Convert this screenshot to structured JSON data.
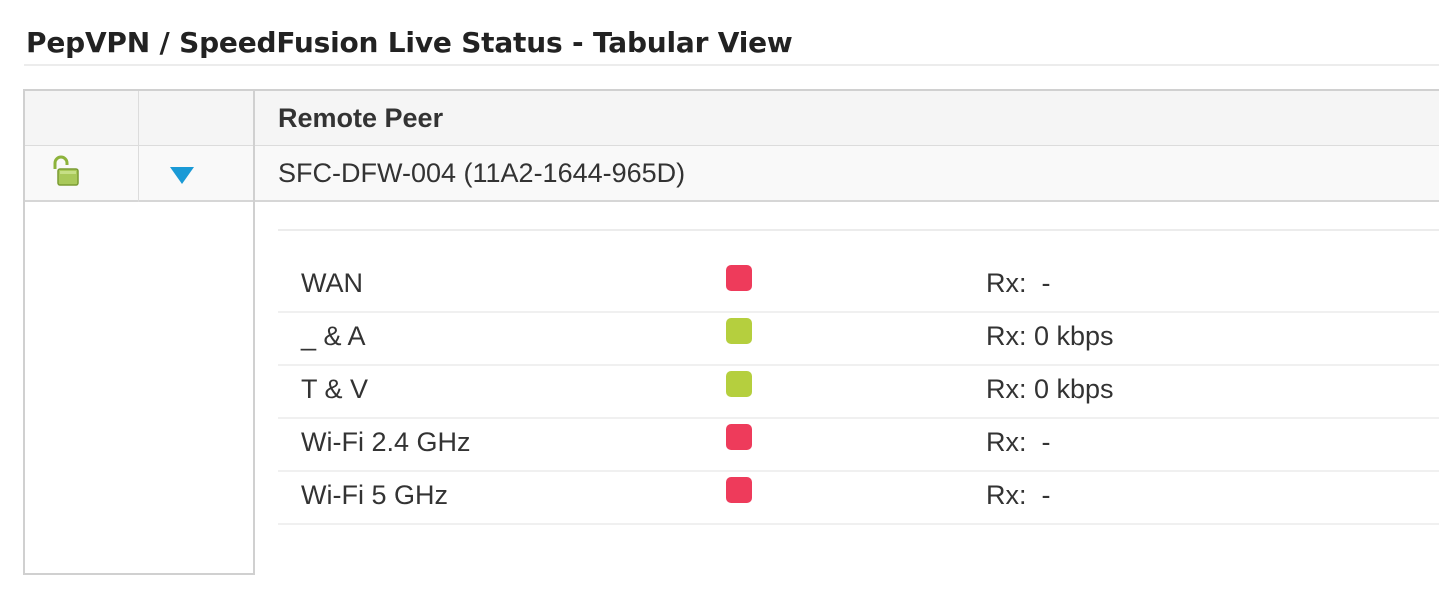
{
  "page": {
    "title": "PepVPN / SpeedFusion Live Status - Tabular View"
  },
  "table": {
    "columns": [
      "",
      "",
      "Remote Peer"
    ],
    "peer": {
      "name": "SFC-DFW-004 (11A2-1644-965D)",
      "lock_icon": "unlocked-padlock-icon",
      "lock_color": "#8db33c",
      "expand_icon": "triangle-down-icon",
      "expand_color": "#1a9ad6"
    },
    "wans": [
      {
        "name": "WAN",
        "status": "down",
        "status_color": "#ee3b5b",
        "rx": "Rx:  -"
      },
      {
        "name": "_ & A",
        "status": "up",
        "status_color": "#b5cf3e",
        "rx": "Rx: 0 kbps"
      },
      {
        "name": "T & V",
        "status": "up",
        "status_color": "#b5cf3e",
        "rx": "Rx: 0 kbps"
      },
      {
        "name": "Wi-Fi 2.4 GHz",
        "status": "down",
        "status_color": "#ee3b5b",
        "rx": "Rx:  -"
      },
      {
        "name": "Wi-Fi 5 GHz",
        "status": "down",
        "status_color": "#ee3b5b",
        "rx": "Rx:  -"
      }
    ]
  }
}
